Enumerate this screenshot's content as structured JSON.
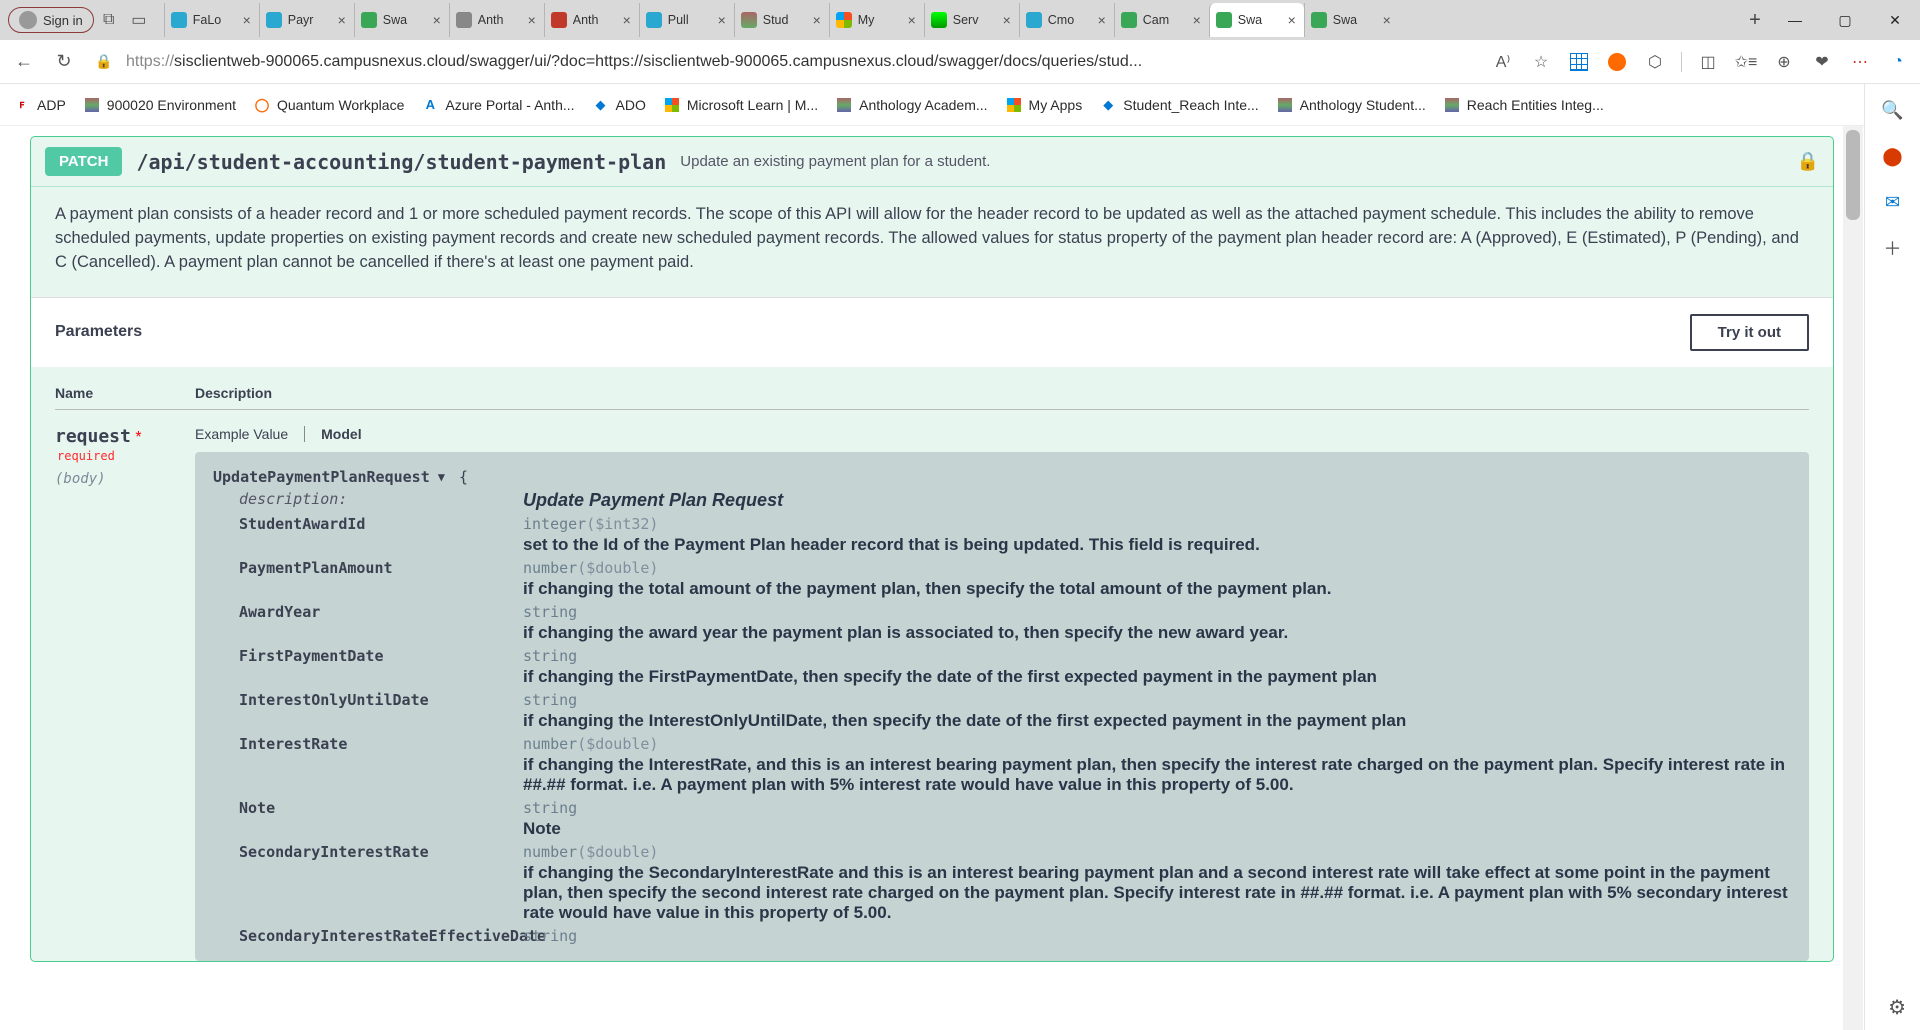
{
  "titleBar": {
    "signIn": "Sign in",
    "tabs": [
      {
        "label": "FaLo",
        "fav": "favteal"
      },
      {
        "label": "Payr",
        "fav": "favteal"
      },
      {
        "label": "Swa",
        "fav": "favgreen"
      },
      {
        "label": "Anth",
        "fav": "favgrey"
      },
      {
        "label": "Anth",
        "fav": "favpdf"
      },
      {
        "label": "Pull",
        "fav": "favteal"
      },
      {
        "label": "Stud",
        "fav": "favbar"
      },
      {
        "label": "My",
        "fav": "favms"
      },
      {
        "label": "Serv",
        "fav": "favsn"
      },
      {
        "label": "Cmo",
        "fav": "favteal"
      },
      {
        "label": "Cam",
        "fav": "favgreen"
      },
      {
        "label": "Swa",
        "fav": "favgreen",
        "active": true
      },
      {
        "label": "Swa",
        "fav": "favgreen"
      }
    ]
  },
  "addressBar": {
    "urlPrefix": "https://",
    "urlBody": "sisclientweb-900065.campusnexus.cloud/swagger/ui/?doc=https://sisclientweb-900065.campusnexus.cloud/swagger/docs/queries/stud..."
  },
  "bookmarks": [
    {
      "label": "ADP",
      "cls": "adp"
    },
    {
      "label": "900020 Environment",
      "cls": "bar"
    },
    {
      "label": "Quantum Workplace",
      "cls": "quantum"
    },
    {
      "label": "Azure Portal - Anth...",
      "cls": "azure"
    },
    {
      "label": "ADO",
      "cls": "ado"
    },
    {
      "label": "Microsoft Learn | M...",
      "cls": "ms"
    },
    {
      "label": "Anthology Academ...",
      "cls": "bar"
    },
    {
      "label": "My Apps",
      "cls": "ms"
    },
    {
      "label": "Student_Reach Inte...",
      "cls": "ado"
    },
    {
      "label": "Anthology Student...",
      "cls": "bar"
    },
    {
      "label": "Reach Entities Integ...",
      "cls": "bar"
    }
  ],
  "swagger": {
    "method": "PATCH",
    "path": "/api/student-accounting/student-payment-plan",
    "summary": "Update an existing payment plan for a student.",
    "description": "A payment plan consists of a header record and 1 or more scheduled payment records. The scope of this API will allow for the header record to be updated as well as the attached payment schedule. This includes the ability to remove scheduled payments, update properties on existing payment records and create new scheduled payment records. The allowed values for status property of the payment plan header record are: A (Approved), E (Estimated), P (Pending), and C (Cancelled). A payment plan cannot be cancelled if there's at least one payment paid.",
    "parametersHeading": "Parameters",
    "tryItOut": "Try it out",
    "columns": {
      "name": "Name",
      "description": "Description"
    },
    "param": {
      "name": "request",
      "required": "required",
      "in": "(body)"
    },
    "tabs": {
      "example": "Example Value",
      "model": "Model"
    },
    "model": {
      "title": "UpdatePaymentPlanRequest",
      "descriptionKey": "description:",
      "descriptionVal": "Update Payment Plan Request",
      "fields": [
        {
          "name": "StudentAwardId",
          "type": "integer",
          "fmt": "($int32)",
          "desc": "set to the Id of the Payment Plan header record that is being updated. This field is required."
        },
        {
          "name": "PaymentPlanAmount",
          "type": "number",
          "fmt": "($double)",
          "desc": "if changing the total amount of the payment plan, then specify the total amount of the payment plan."
        },
        {
          "name": "AwardYear",
          "type": "string",
          "fmt": "",
          "desc": "if changing the award year the payment plan is associated to, then specify the new award year."
        },
        {
          "name": "FirstPaymentDate",
          "type": "string",
          "fmt": "",
          "desc": "if changing the FirstPaymentDate, then specify the date of the first expected payment in the payment plan"
        },
        {
          "name": "InterestOnlyUntilDate",
          "type": "string",
          "fmt": "",
          "desc": "if changing the InterestOnlyUntilDate, then specify the date of the first expected payment in the payment plan"
        },
        {
          "name": "InterestRate",
          "type": "number",
          "fmt": "($double)",
          "desc": "if changing the InterestRate, and this is an interest bearing payment plan, then specify the interest rate charged on the payment plan. Specify interest rate in ##.## format. i.e. A payment plan with 5% interest rate would have value in this property of 5.00."
        },
        {
          "name": "Note",
          "type": "string",
          "fmt": "",
          "desc": "Note"
        },
        {
          "name": "SecondaryInterestRate",
          "type": "number",
          "fmt": "($double)",
          "desc": "if changing the SecondaryInterestRate and this is an interest bearing payment plan and a second interest rate will take effect at some point in the payment plan, then specify the second interest rate charged on the payment plan. Specify interest rate in ##.## format. i.e. A payment plan with 5% secondary interest rate would have value in this property of 5.00."
        },
        {
          "name": "SecondaryInterestRateEffectiveDate",
          "type": "string",
          "fmt": "",
          "desc": ""
        }
      ]
    }
  }
}
